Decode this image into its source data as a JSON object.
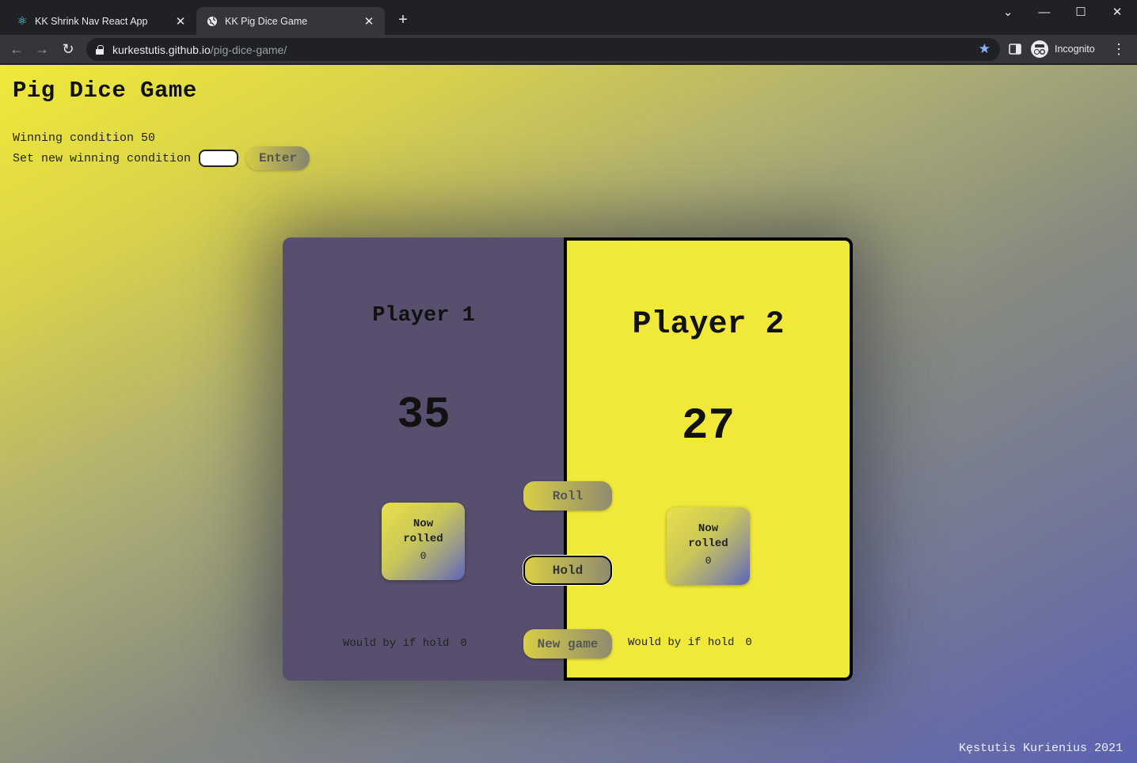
{
  "browser": {
    "tabs": [
      {
        "title": "KK Shrink Nav React App",
        "active": false,
        "icon": "react-icon"
      },
      {
        "title": "KK Pig Dice Game",
        "active": true,
        "icon": "globe-icon"
      }
    ],
    "url_host": "kurkestutis.github.io",
    "url_path": "/pig-dice-game/",
    "incognito_label": "Incognito"
  },
  "page": {
    "title": "Pig Dice Game",
    "winning_label": "Winning condition",
    "winning_value": "50",
    "set_label": "Set new winning condition",
    "enter_label": "Enter",
    "footer": "Kęstutis Kurienius 2021"
  },
  "game": {
    "players": [
      {
        "name": "Player 1",
        "score": "35",
        "rolled_label": "Now rolled",
        "rolled_value": "0",
        "hold_label": "Would by if hold",
        "hold_value": "0"
      },
      {
        "name": "Player 2",
        "score": "27",
        "rolled_label": "Now rolled",
        "rolled_value": "0",
        "hold_label": "Would by if hold",
        "hold_value": "0"
      }
    ],
    "roll_label": "Roll",
    "hold_label": "Hold",
    "new_game_label": "New game"
  },
  "colors": {
    "player1_bg": "#574f6d",
    "player2_bg": "#f0e93a",
    "page_gradient_start": "#f0e93a",
    "page_gradient_end": "#5c63b2"
  }
}
